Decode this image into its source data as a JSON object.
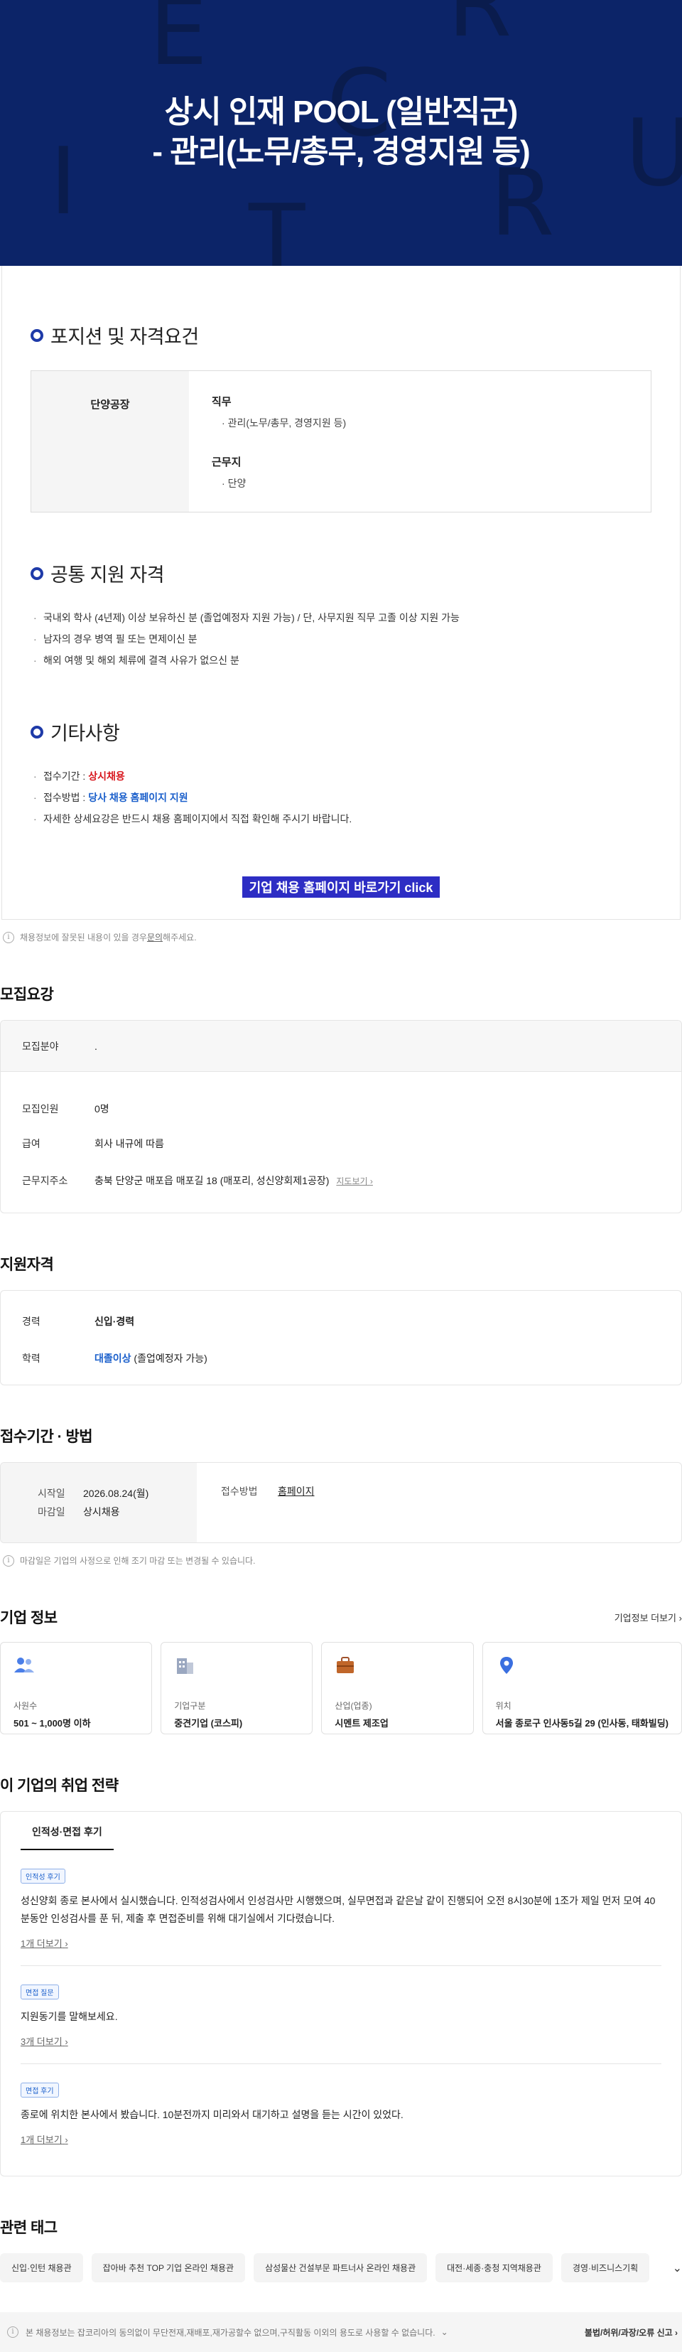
{
  "hero": {
    "title_line1": "상시 인재 POOL (일반직군)",
    "title_line2": "- 관리(노무/총무, 경영지원 등)",
    "deco_letters": [
      "E",
      "I",
      "C",
      "R",
      "T",
      "R",
      "U",
      "R"
    ]
  },
  "position": {
    "title": "포지션 및 자격요건",
    "site": "단양공장",
    "duty_label": "직무",
    "duty_value": "관리(노무/총무, 경영지원 등)",
    "location_label": "근무지",
    "location_value": "단양"
  },
  "common": {
    "title": "공통 지원 자격",
    "items": [
      "국내외 학사 (4년제) 이상 보유하신 분 (졸업예정자 지원 가능) / 단, 사무지원 직무 고졸 이상 지원 가능",
      "남자의 경우 병역 필 또는 면제이신 분",
      "해외 여행 및 해외 체류에 결격 사유가 없으신 분"
    ]
  },
  "etc": {
    "title": "기타사항",
    "period_label": "접수기간 : ",
    "period_value": "상시채용",
    "method_label": "접수방법 : ",
    "method_value": "당사 채용 홈페이지 지원",
    "note": "자세한 상세요강은 반드시 채용 홈페이지에서 직접 확인해 주시기 바랍니다."
  },
  "cta_label": "기업 채용 홈페이지 바로가기 click",
  "report_notice": {
    "text_before": "채용정보에 잘못된 내용이 있을 경우 ",
    "link": "문의",
    "text_after": "해주세요."
  },
  "recruit": {
    "title": "모집요강",
    "field_label": "모집분야",
    "field_value": ".",
    "headcount_label": "모집인원",
    "headcount_value": "0명",
    "salary_label": "급여",
    "salary_value": "회사 내규에 따름",
    "address_label": "근무지주소",
    "address_value": "충북 단양군 매포읍 매포길 18 (매포리, 성신양회제1공장)",
    "map_link": "지도보기"
  },
  "qualification": {
    "title": "지원자격",
    "career_label": "경력",
    "career_value": "신입·경력",
    "edu_label": "학력",
    "edu_value_strong": "대졸이상",
    "edu_value_rest": " (졸업예정자 가능)"
  },
  "period": {
    "title": "접수기간 · 방법",
    "start_label": "시작일",
    "start_value": "2026.08.24(월)",
    "end_label": "마감일",
    "end_value": "상시채용",
    "method_label": "접수방법",
    "method_value": "홈페이지",
    "notice": "마감일은 기업의 사정으로 인해 조기 마감 또는 변경될 수 있습니다."
  },
  "company": {
    "title": "기업 정보",
    "more": "기업정보 더보기",
    "cards": [
      {
        "icon": "people-icon",
        "label": "사원수",
        "value": "501 ~ 1,000명 이하"
      },
      {
        "icon": "building-icon",
        "label": "기업구분",
        "value": "중견기업 (코스피)"
      },
      {
        "icon": "briefcase-icon",
        "label": "산업(업종)",
        "value": "시멘트 제조업"
      },
      {
        "icon": "location-pin-icon",
        "label": "위치",
        "value": "서울 종로구 인사동5길 29 (인사동, 태화빌딩)"
      }
    ]
  },
  "strategy": {
    "title": "이 기업의 취업 전략",
    "tab": "인적성·면접 후기",
    "reviews": [
      {
        "badge": "인적성 후기",
        "text": "성신양회 종로 본사에서 실시했습니다. 인적성검사에서 인성검사만 시행했으며, 실무면접과 같은날 같이 진행되어 오전 8시30분에 1조가 제일 먼저 모여 40분동안 인성검사를 푼 뒤, 제출 후 면접준비를 위해 대기실에서 기다렸습니다.",
        "more": "1개 더보기"
      },
      {
        "badge": "면접 질문",
        "text": "지원동기를 말해보세요.",
        "more": "3개 더보기"
      },
      {
        "badge": "면접 후기",
        "text": "종로에 위치한 본사에서 봤습니다. 10분전까지 미리와서 대기하고 설명을 듣는 시간이 있었다.",
        "more": "1개 더보기"
      }
    ]
  },
  "tags": {
    "title": "관련 태그",
    "items": [
      "신입·인턴 채용관",
      "잡아바 추천 TOP 기업 온라인 채용관",
      "삼성물산 건설부문 파트너사 온라인 채용관",
      "대전·세종·충청 지역채용관",
      "경영·비즈니스기획"
    ]
  },
  "footer": {
    "notice": "본 채용정보는 잡코리아의 동의없이 무단전재,재배포,재가공할수 없으며,구직활동 이외의 용도로 사용할 수 없습니다.",
    "report": "불법/허위/과장/오류 신고"
  }
}
